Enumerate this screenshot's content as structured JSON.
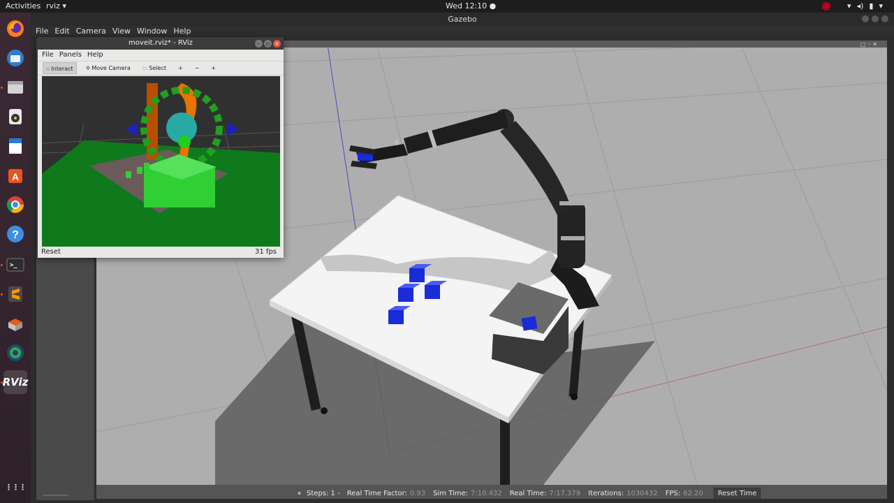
{
  "topbar": {
    "activities": "Activities",
    "app_menu": "rviz ▾",
    "clock": "Wed 12:10 ●",
    "tray_icons": [
      "record-indicator",
      "wifi-icon",
      "volume-icon",
      "battery-icon",
      "chevron-down-icon"
    ]
  },
  "dock": {
    "items": [
      "firefox",
      "thunderbird",
      "files",
      "rhythmbox",
      "libreoffice-writer",
      "ubuntu-software",
      "chrome",
      "help",
      "terminal",
      "sublime-text",
      "package-manager",
      "camera-app",
      "rviz"
    ],
    "rviz_label": "RViz",
    "show_apps": "⋮⋮⋮"
  },
  "gazebo": {
    "title": "Gazebo",
    "menu": [
      "File",
      "Edit",
      "Camera",
      "View",
      "Window",
      "Help"
    ],
    "bottom": {
      "pause_glyph": "⏸",
      "steps_label": "Steps: 1 -",
      "rtf_label": "Real Time Factor:",
      "rtf_value": "0.93",
      "sim_time_label": "Sim Time:",
      "sim_time_value": "7:10.432",
      "real_time_label": "Real Time:",
      "real_time_value": "7:17.379",
      "iterations_label": "Iterations:",
      "iterations_value": "1030432",
      "fps_label": "FPS:",
      "fps_value": "62.20",
      "reset_time": "Reset Time"
    }
  },
  "rviz": {
    "title": "moveit.rviz* - RViz",
    "menu": [
      "File",
      "Panels",
      "Help"
    ],
    "tools": {
      "interact": "Interact",
      "move_camera": "Move Camera",
      "select": "Select"
    },
    "status": {
      "reset": "Reset",
      "fps": "31 fps"
    }
  }
}
